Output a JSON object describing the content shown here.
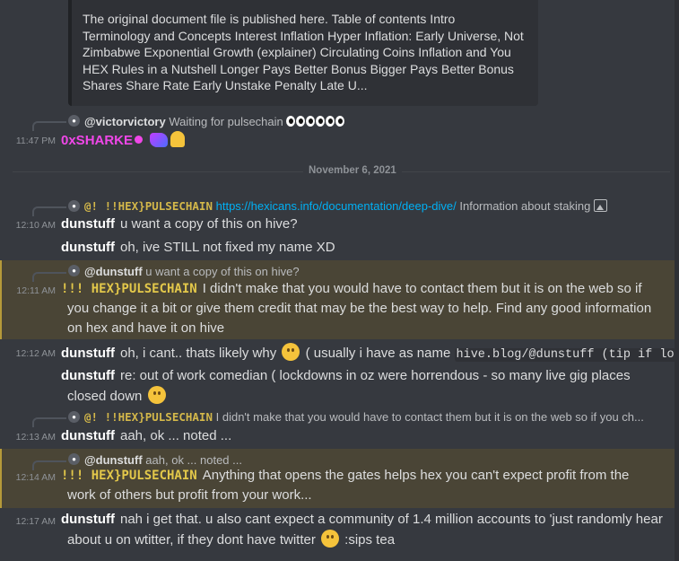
{
  "embed": {
    "description": "The original document file is published here. Table of contents Intro Terminology and Concepts Interest Inflation Hyper Inflation: Early Universe, Not Zimbabwe Exponential Growth (explainer) Circulating Coins Inflation and You HEX Rules in a Nutshell Longer Pays Better Bonus Bigger Pays Better Bonus Shares Share Rate Early Unstake Penalty Late U..."
  },
  "date_divider": "November 6, 2021",
  "messages": [
    {
      "reply_name": "@victorvictory",
      "reply_text": "Waiting for pulsechain",
      "time": "11:47 PM",
      "author": "0xSHARKE",
      "text": ""
    },
    {
      "reply_name": "@! !!HEX}PULSECHAIN",
      "reply_link": "https://hexicans.info/documentation/deep-dive/",
      "reply_text": "Information about staking",
      "time": "12:10 AM",
      "author": "dunstuff",
      "text": "u want a copy of this on hive?"
    },
    {
      "author": "dunstuff",
      "text": "oh, ive STILL not fixed my name XD"
    },
    {
      "reply_name": "@dunstuff",
      "reply_text": "u want a copy of this on hive?",
      "time": "12:11 AM",
      "author": "!!! HEX}PULSECHAIN",
      "text_line1": "I didn't make that you would have to contact them but it is on the web so if",
      "text_line2": "you change it a bit or give them credit that may be the best way to help.  Find any good information",
      "text_line3": "on hex and have it on hive"
    },
    {
      "time": "12:12 AM",
      "author": "dunstuff",
      "text_a": "oh, i cant.. thats likely why",
      "text_b": "( usually i have as name",
      "code": "hive.blog/@dunstuff (tip if lol)"
    },
    {
      "author": "dunstuff",
      "text_line1": "re: out of work comedian ( lockdowns in oz were horrendous - so many live gig places",
      "text_line2": "closed down"
    },
    {
      "reply_name": "@! !!HEX}PULSECHAIN",
      "reply_text": "I didn't make that you would have to contact them but it is on the web so if you ch...",
      "time": "12:13 AM",
      "author": "dunstuff",
      "text": "aah, ok ... noted ..."
    },
    {
      "reply_name": "@dunstuff",
      "reply_text": "aah, ok ... noted ...",
      "time": "12:14 AM",
      "author": "!!! HEX}PULSECHAIN",
      "text_line1": "Anything that opens the gates helps hex you can't expect profit from the",
      "text_line2": "work of others but profit from your work..."
    },
    {
      "time": "12:17 AM",
      "author": "dunstuff",
      "text_line1": "nah i get that. u also cant expect a community of 1.4 million accounts to 'just randomly hear",
      "text_line2": "about u on wtitter, if they dont have twitter",
      "text_line3": ":sips tea"
    }
  ]
}
